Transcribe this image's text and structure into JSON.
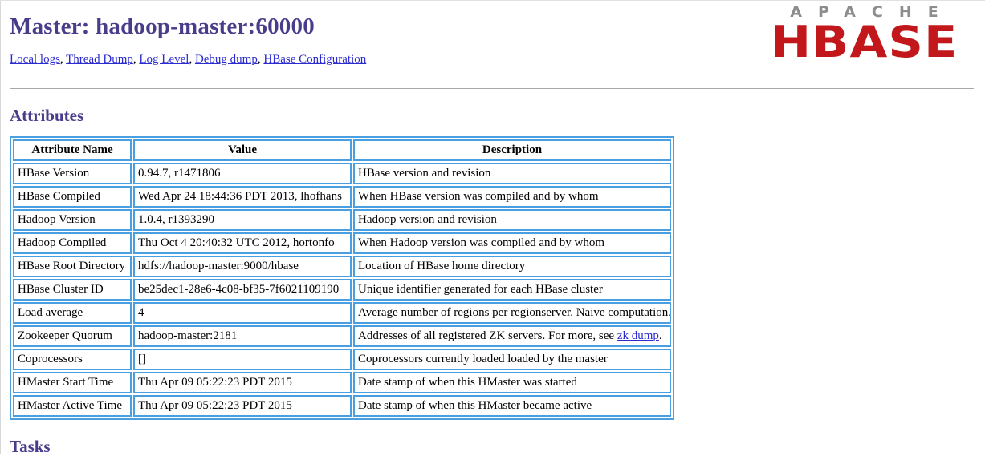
{
  "header": {
    "title": "Master: hadoop-master:60000",
    "nav_links": [
      {
        "label": "Local logs"
      },
      {
        "label": "Thread Dump"
      },
      {
        "label": "Log Level"
      },
      {
        "label": "Debug dump"
      },
      {
        "label": "HBase Configuration"
      }
    ],
    "nav_separator": ", "
  },
  "logo": {
    "top_text": "APACHE",
    "main_text": "HBASE",
    "top_color": "#8d8d8d",
    "main_color": "#c2181b"
  },
  "sections": {
    "attributes_heading": "Attributes",
    "tasks_heading": "Tasks"
  },
  "colors": {
    "heading": "#483d8b",
    "link": "#2b2bd0",
    "table_border": "#4a9fe0",
    "divider": "#a9a9a9"
  },
  "attributes_table": {
    "columns": [
      "Attribute Name",
      "Value",
      "Description"
    ],
    "rows": [
      {
        "name": "HBase Version",
        "value": "0.94.7, r1471806",
        "description": "HBase version and revision"
      },
      {
        "name": "HBase Compiled",
        "value": "Wed Apr 24 18:44:36 PDT 2013, lhofhans",
        "description": "When HBase version was compiled and by whom"
      },
      {
        "name": "Hadoop Version",
        "value": "1.0.4, r1393290",
        "description": "Hadoop version and revision"
      },
      {
        "name": "Hadoop Compiled",
        "value": "Thu Oct 4 20:40:32 UTC 2012, hortonfo",
        "description": "When Hadoop version was compiled and by whom"
      },
      {
        "name": "HBase Root Directory",
        "value": "hdfs://hadoop-master:9000/hbase",
        "description": "Location of HBase home directory"
      },
      {
        "name": "HBase Cluster ID",
        "value": "be25dec1-28e6-4c08-bf35-7f6021109190",
        "description": "Unique identifier generated for each HBase cluster"
      },
      {
        "name": "Load average",
        "value": "4",
        "description": "Average number of regions per regionserver. Naive computation."
      },
      {
        "name": "Zookeeper Quorum",
        "value": "hadoop-master:2181",
        "description_prefix": "Addresses of all registered ZK servers. For more, see ",
        "description_link": "zk dump",
        "description_suffix": "."
      },
      {
        "name": "Coprocessors",
        "value": "[]",
        "description": "Coprocessors currently loaded loaded by the master"
      },
      {
        "name": "HMaster Start Time",
        "value": "Thu Apr 09 05:22:23 PDT 2015",
        "description": "Date stamp of when this HMaster was started"
      },
      {
        "name": "HMaster Active Time",
        "value": "Thu Apr 09 05:22:23 PDT 2015",
        "description": "Date stamp of when this HMaster became active"
      }
    ]
  }
}
